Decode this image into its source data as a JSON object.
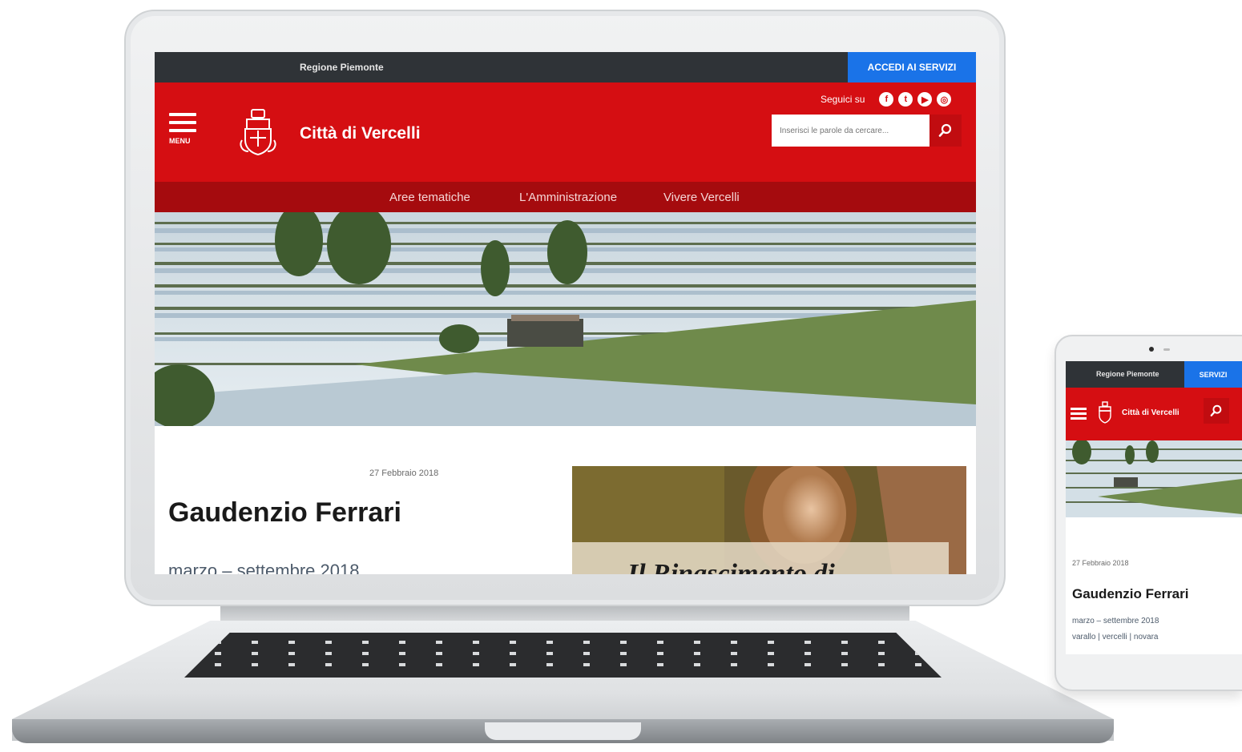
{
  "desktop": {
    "topbar": {
      "region": "Regione Piemonte",
      "access": "ACCEDI AI SERVIZI"
    },
    "header": {
      "menu_label": "MENU",
      "title": "Città di Vercelli",
      "follow_label": "Seguici su",
      "search_placeholder": "Inserisci le parole da cercare..."
    },
    "nav": [
      "Aree tematiche",
      "L'Amministrazione",
      "Vivere Vercelli"
    ],
    "article": {
      "date": "27 Febbraio 2018",
      "title": "Gaudenzio Ferrari",
      "subtitle": "marzo – settembre 2018",
      "feature_caption": "Il Rinascimento di"
    },
    "colors": {
      "topbar": "#2f3337",
      "brand_red": "#d50e12",
      "nav_red": "#a50b0e",
      "access_blue": "#1a73e8"
    },
    "social_icons": [
      "facebook-icon",
      "twitter-icon",
      "youtube-icon",
      "instagram-icon"
    ]
  },
  "mobile": {
    "topbar": {
      "region": "Regione Piemonte",
      "access": "SERVIZI"
    },
    "header": {
      "title": "Città di Vercelli"
    },
    "article": {
      "date": "27 Febbraio 2018",
      "title": "Gaudenzio Ferrari",
      "subtitle": "marzo – settembre 2018",
      "locations": "varallo | vercelli | novara"
    }
  }
}
